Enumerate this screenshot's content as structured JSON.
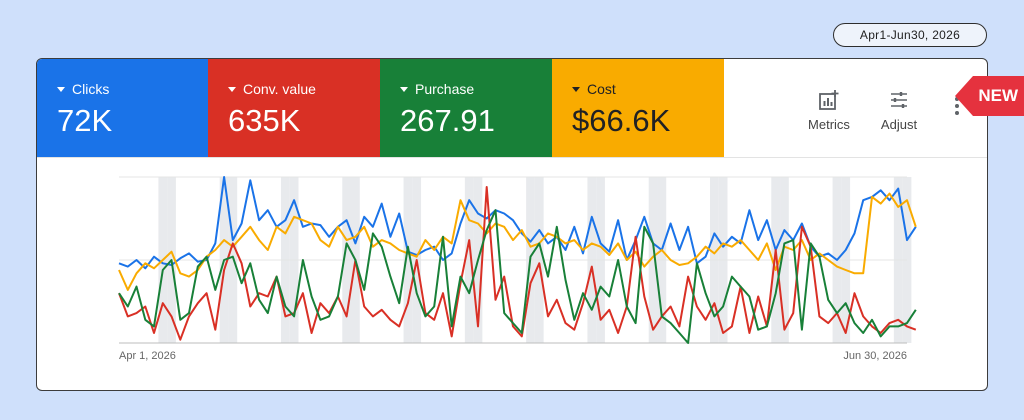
{
  "date_range": "Apr1-Jun30, 2026",
  "badge": "NEW",
  "metrics": [
    {
      "label": "Clicks",
      "value": "72K",
      "color": "#1a73e8"
    },
    {
      "label": "Conv. value",
      "value": "635K",
      "color": "#d93025"
    },
    {
      "label": "Purchase",
      "value": "267.91",
      "color": "#188038"
    },
    {
      "label": "Cost",
      "value": "$66.6K",
      "color": "#f9ab00"
    }
  ],
  "tools": {
    "metrics_label": "Metrics",
    "adjust_label": "Adjust"
  },
  "chart_data": {
    "type": "line",
    "x_start_label": "Apr 1, 2026",
    "x_end_label": "Jun 30, 2026",
    "x_count": 91,
    "ylim": [
      0,
      100
    ],
    "grid": true,
    "weekend_bands": [
      5,
      6,
      12,
      13,
      19,
      20,
      26,
      27,
      33,
      34,
      40,
      41,
      47,
      48,
      54,
      55,
      61,
      62,
      68,
      69,
      75,
      76,
      82,
      83,
      89,
      90
    ],
    "series": [
      {
        "color": "#1a73e8",
        "values": [
          48,
          46,
          50,
          45,
          52,
          48,
          47,
          51,
          54,
          49,
          50,
          60,
          100,
          62,
          72,
          98,
          74,
          80,
          70,
          74,
          86,
          70,
          72,
          71,
          64,
          70,
          74,
          60,
          76,
          70,
          84,
          64,
          78,
          55,
          53,
          56,
          58,
          50,
          54,
          72,
          86,
          78,
          75,
          80,
          78,
          74,
          66,
          61,
          68,
          60,
          64,
          56,
          70,
          54,
          76,
          60,
          55,
          74,
          50,
          62,
          76,
          60,
          56,
          72,
          56,
          70,
          48,
          52,
          66,
          58,
          64,
          60,
          80,
          62,
          74,
          56,
          68,
          62,
          72,
          58,
          52,
          54,
          50,
          56,
          66,
          86,
          88,
          92,
          86,
          93,
          62,
          70
        ]
      },
      {
        "color": "#f9ab00",
        "values": [
          44,
          32,
          42,
          48,
          45,
          50,
          55,
          42,
          40,
          44,
          52,
          56,
          62,
          58,
          64,
          70,
          62,
          56,
          70,
          66,
          76,
          74,
          72,
          62,
          58,
          70,
          62,
          64,
          70,
          58,
          62,
          60,
          56,
          54,
          52,
          62,
          56,
          64,
          60,
          86,
          74,
          72,
          66,
          72,
          70,
          62,
          68,
          58,
          60,
          66,
          64,
          60,
          62,
          56,
          60,
          58,
          53,
          60,
          50,
          55,
          46,
          52,
          56,
          50,
          47,
          48,
          52,
          58,
          54,
          60,
          58,
          62,
          56,
          50,
          60,
          44,
          58,
          56,
          62,
          50,
          54,
          50,
          46,
          44,
          42,
          42,
          88,
          84,
          90,
          82,
          86,
          70
        ]
      },
      {
        "color": "#d93025",
        "values": [
          30,
          16,
          18,
          22,
          6,
          24,
          16,
          2,
          16,
          24,
          30,
          8,
          44,
          60,
          48,
          22,
          30,
          28,
          40,
          16,
          18,
          30,
          6,
          24,
          18,
          28,
          16,
          50,
          22,
          16,
          20,
          14,
          10,
          24,
          50,
          18,
          14,
          30,
          4,
          36,
          62,
          10,
          94,
          26,
          40,
          10,
          4,
          36,
          48,
          16,
          26,
          12,
          8,
          24,
          46,
          14,
          20,
          6,
          22,
          64,
          28,
          8,
          16,
          22,
          10,
          40,
          22,
          14,
          24,
          6,
          10,
          34,
          6,
          28,
          10,
          56,
          8,
          18,
          70,
          58,
          16,
          12,
          18,
          6,
          30,
          16,
          10,
          6,
          12,
          14,
          10,
          8
        ]
      },
      {
        "color": "#188038",
        "values": [
          30,
          22,
          34,
          14,
          10,
          44,
          50,
          14,
          18,
          46,
          52,
          32,
          50,
          52,
          36,
          48,
          26,
          18,
          40,
          22,
          16,
          50,
          28,
          14,
          16,
          28,
          60,
          50,
          32,
          66,
          58,
          40,
          24,
          58,
          30,
          16,
          22,
          64,
          10,
          40,
          30,
          50,
          68,
          80,
          18,
          12,
          6,
          52,
          60,
          40,
          70,
          38,
          14,
          30,
          20,
          34,
          28,
          50,
          22,
          12,
          70,
          60,
          16,
          12,
          6,
          0,
          48,
          30,
          16,
          22,
          40,
          34,
          28,
          8,
          10,
          30,
          60,
          62,
          8,
          60,
          52,
          26,
          18,
          24,
          12,
          6,
          14,
          4,
          10,
          10,
          12,
          20
        ]
      }
    ]
  }
}
